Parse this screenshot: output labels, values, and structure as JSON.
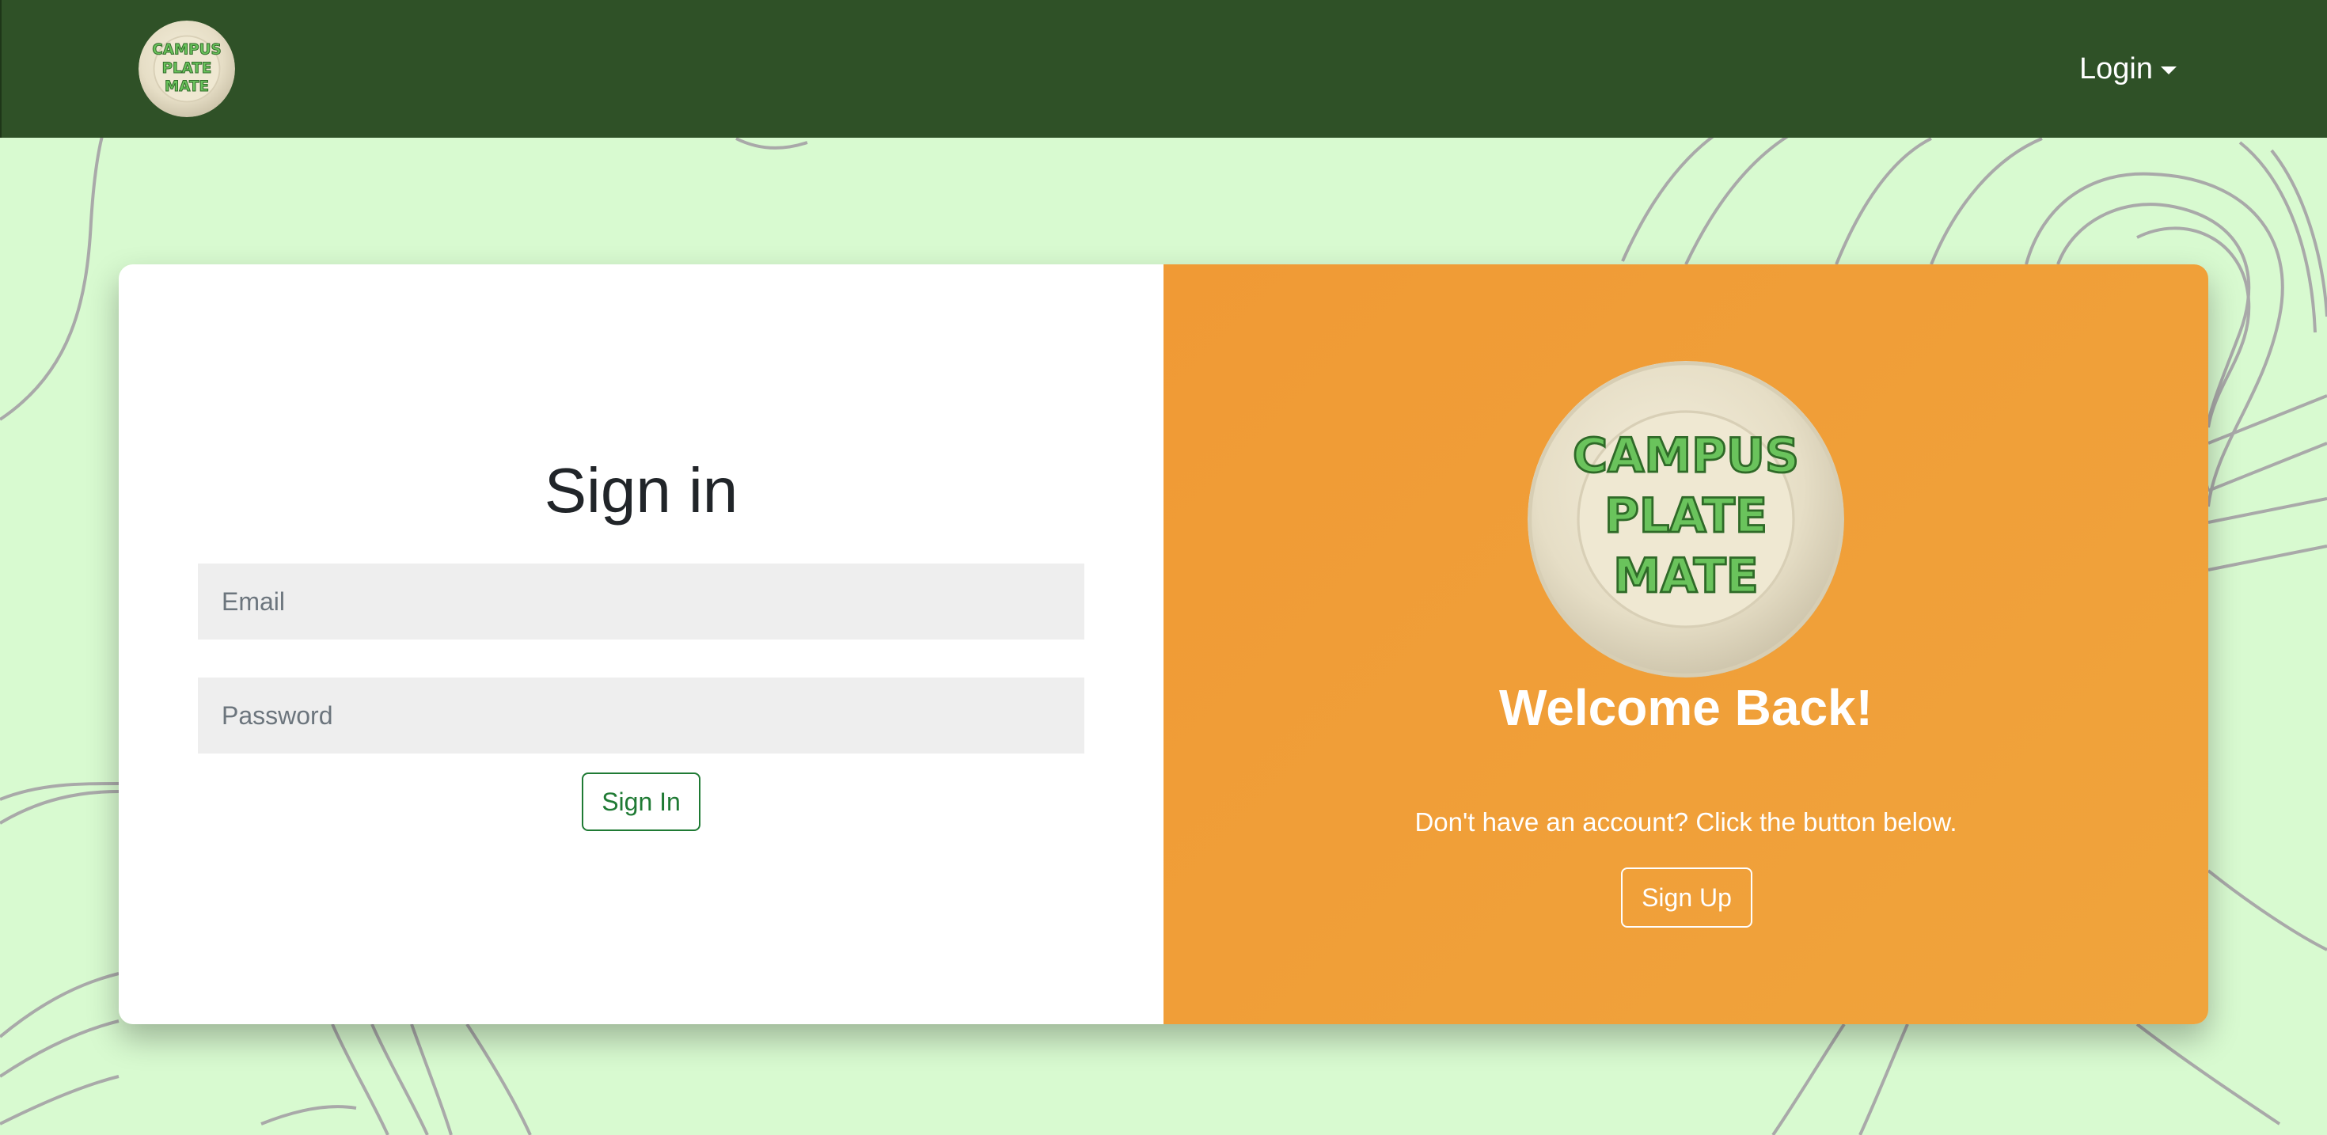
{
  "brand": {
    "logo_lines": [
      "CAMPUS",
      "PLATE",
      "MATE"
    ],
    "logo_icon": "plate-logo"
  },
  "navbar": {
    "login_label": "Login",
    "login_icon": "caret-down-icon",
    "bg_color": "#2f5127"
  },
  "signin": {
    "title": "Sign in",
    "email_placeholder": "Email",
    "email_value": "",
    "password_placeholder": "Password",
    "password_value": "",
    "button_label": "Sign In"
  },
  "welcome": {
    "title": "Welcome Back!",
    "prompt": "Don't have an account? Click the button below.",
    "button_label": "Sign Up",
    "panel_color": "#f0a03a"
  },
  "colors": {
    "page_bg": "#d8fad0",
    "accent_green": "#1f7a34",
    "logo_text": "#6ac35c"
  }
}
